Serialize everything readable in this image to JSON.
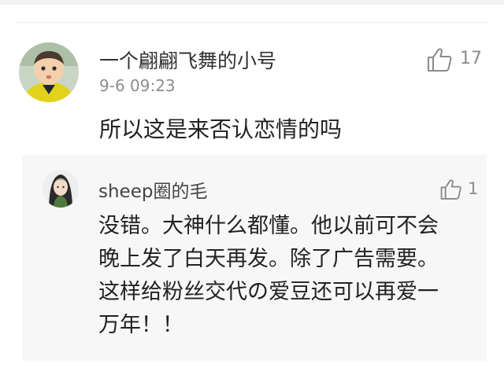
{
  "comment": {
    "username": "一个翩翩飞舞的小号",
    "timestamp": "9-6 09:23",
    "like_count": "17",
    "text": "所以这是来否认恋情的吗"
  },
  "reply": {
    "username": "sheep圈的毛",
    "like_count": "1",
    "lines": [
      "没错。大神什么都懂。他以前可不会",
      "晚上发了白天再发。除了广告需要。",
      "这样给粉丝交代の爱豆还可以再爱一",
      "万年！！"
    ]
  },
  "icons": {
    "like": "thumbs-up-icon"
  },
  "colors": {
    "primary_text": "#222222",
    "secondary_text": "#8c8c8c",
    "reply_background": "#f7f7f7"
  }
}
